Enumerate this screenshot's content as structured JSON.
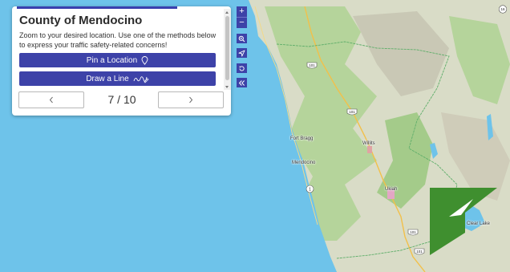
{
  "panel": {
    "title": "County of Mendocino",
    "description": "Zoom to your desired location. Use one of the methods below to express your traffic safety-related concerns!",
    "pin_button_label": "Pin a Location",
    "line_button_label": "Draw a Line",
    "pager": {
      "current": 7,
      "total": 10,
      "display": "7 / 10"
    }
  },
  "map_controls": {
    "zoom_in": "+",
    "zoom_out": "−"
  },
  "map_labels": {
    "fort_bragg": "Fort Bragg",
    "mendocino": "Mendocino",
    "willits": "Willits",
    "ukiah": "Ukiah",
    "clear_lake": "Clear Lake"
  },
  "route_shields": {
    "us101": "101",
    "ca1": "1",
    "ca16": "16"
  },
  "colors": {
    "accent": "#3d42a8",
    "ocean": "#6ec3ea",
    "land": "#dcdcc8",
    "forest": "#a9cf8f",
    "logo_green": "#3f8f2f"
  }
}
